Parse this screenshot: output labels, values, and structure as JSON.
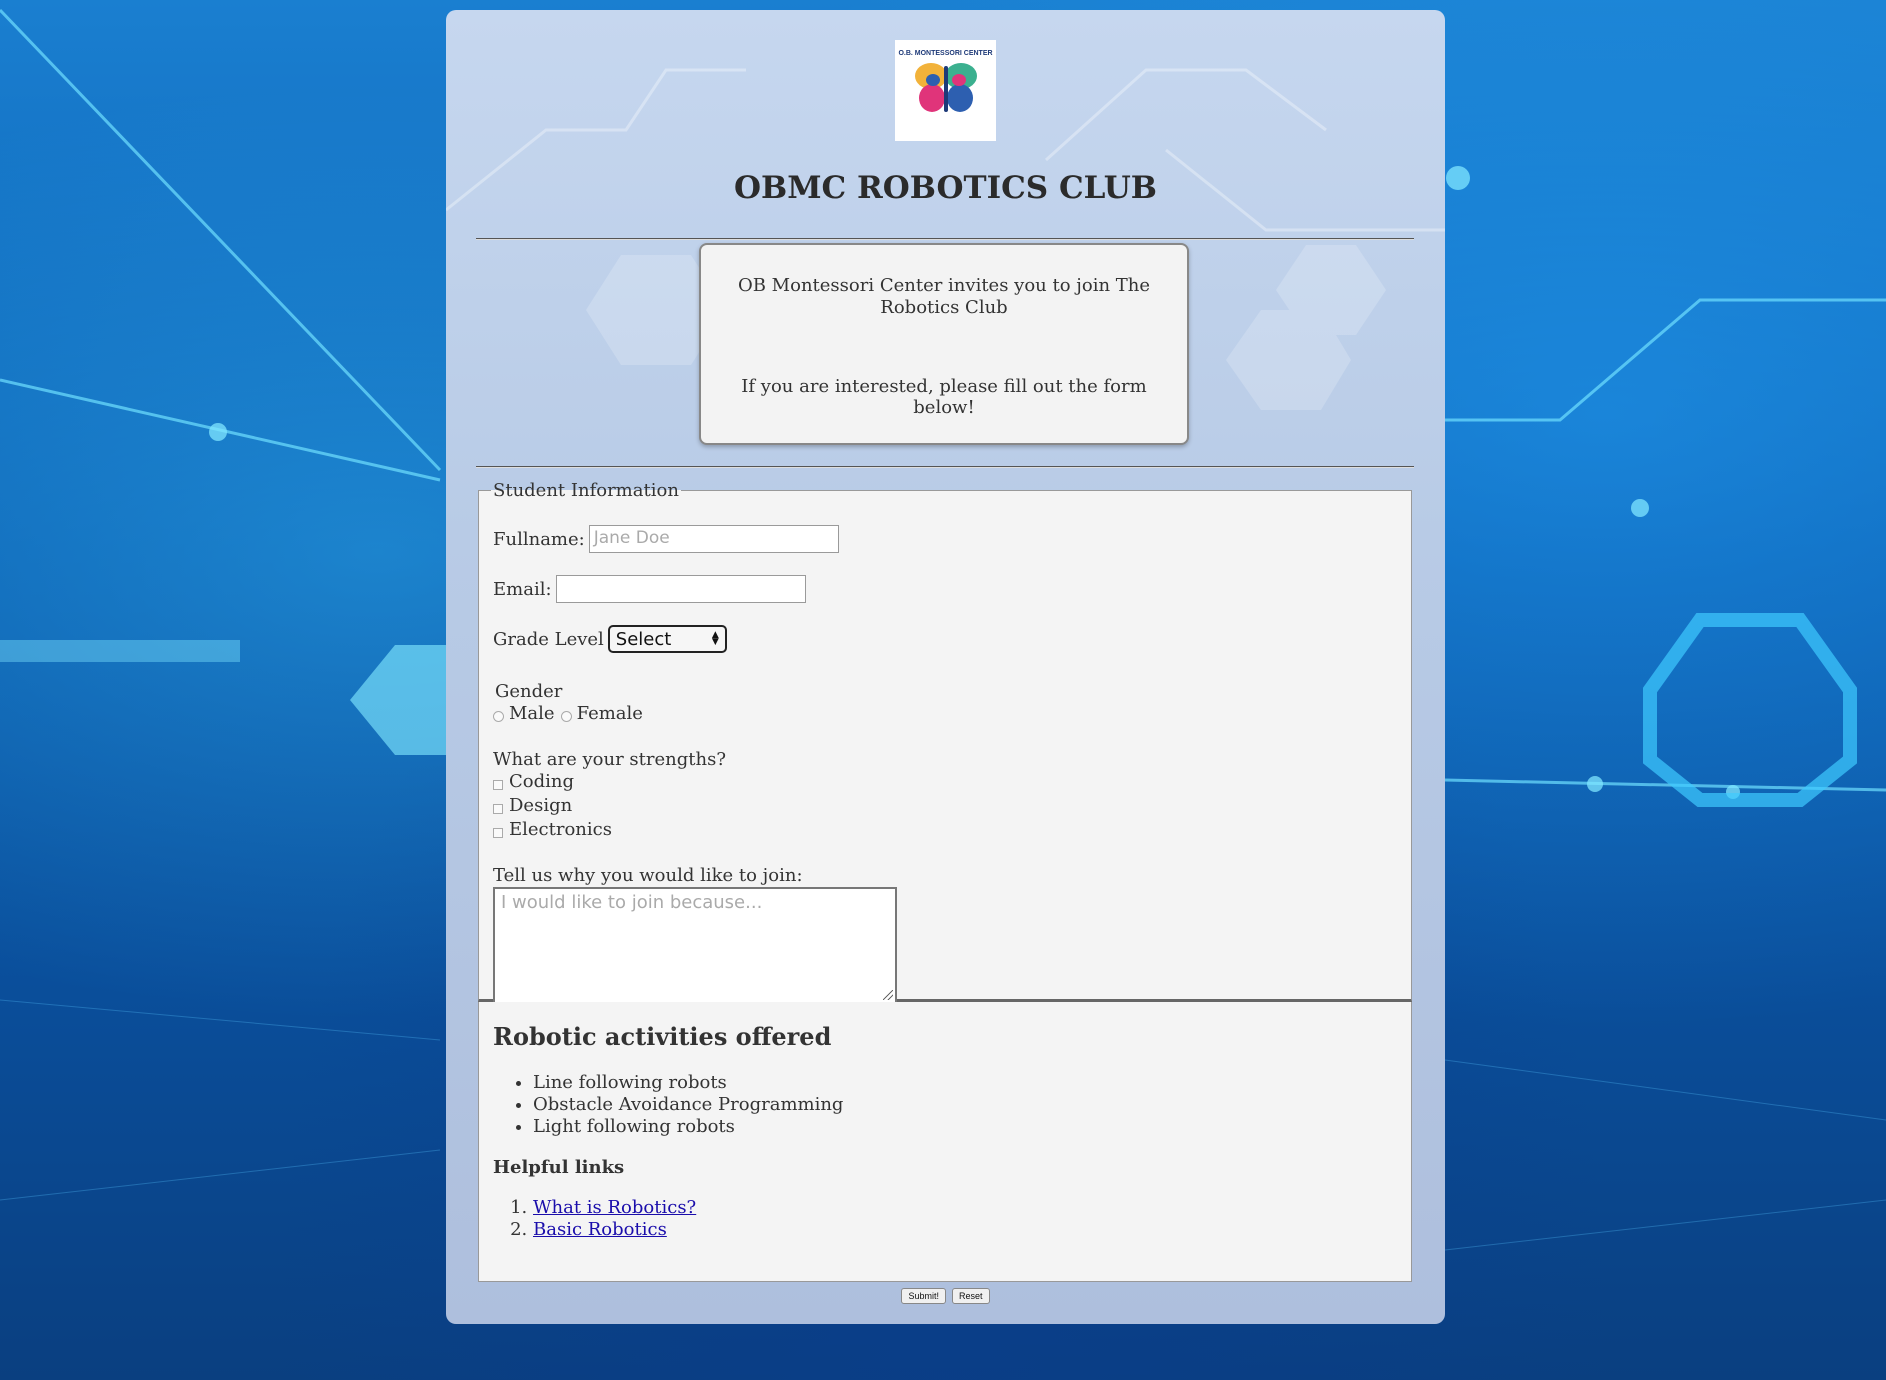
{
  "logo": {
    "text": "O.B. MONTESSORI CENTER"
  },
  "page": {
    "title": "OBMC ROBOTICS CLUB"
  },
  "invite": {
    "line1": "OB Montessori Center invites you to join The Robotics Club",
    "line2": "If you are interested, please fill out the form below!"
  },
  "form": {
    "legend": "Student Information",
    "fullname_label": "Fullname:",
    "fullname_placeholder": "Jane Doe",
    "email_label": "Email:",
    "grade_label": "Grade Level",
    "grade_selected": "Select",
    "gender_label": "Gender",
    "gender_options": [
      "Male",
      "Female"
    ],
    "strengths_label": "What are your strengths?",
    "strengths": [
      "Coding",
      "Design",
      "Electronics"
    ],
    "why_label": "Tell us why you would like to join:",
    "why_placeholder": "I would like to join because..."
  },
  "activities": {
    "heading": "Robotic activities offered",
    "items": [
      "Line following robots",
      "Obstacle Avoidance Programming",
      "Light following robots"
    ],
    "links_heading": "Helpful links",
    "links": [
      "What is Robotics?",
      "Basic Robotics"
    ]
  },
  "buttons": {
    "submit": "Submit!",
    "reset": "Reset"
  },
  "colors": {
    "link": "#1a0dab",
    "background_blue": "#0b5fb3"
  }
}
